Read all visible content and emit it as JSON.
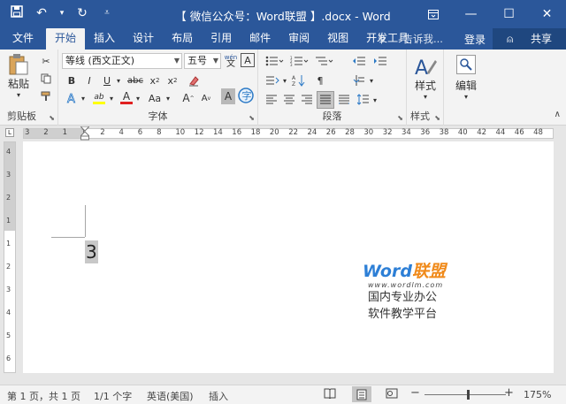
{
  "titlebar": {
    "title": "【 微信公众号：Word联盟 】.docx - Word",
    "qat": {
      "save": "save-icon",
      "undo": "undo-icon",
      "redo": "redo-icon",
      "customize": "customize-icon"
    }
  },
  "tabs": [
    "文件",
    "开始",
    "插入",
    "设计",
    "布局",
    "引用",
    "邮件",
    "审阅",
    "视图",
    "开发工具"
  ],
  "active_tab": "开始",
  "tell_me": "告诉我...",
  "signin": "登录",
  "share": "共享",
  "ribbon": {
    "clipboard": {
      "label": "剪贴板",
      "paste": "粘贴"
    },
    "font": {
      "label": "字体",
      "font_name": "等线 (西文正文)",
      "font_size": "五号",
      "phonetic": "wén"
    },
    "paragraph": {
      "label": "段落"
    },
    "styles": {
      "label": "样式",
      "button": "样式"
    },
    "editing": {
      "button": "编辑"
    }
  },
  "ruler": {
    "h_numbers": [
      "3",
      "2",
      "1",
      "1",
      "2",
      "4",
      "6",
      "8",
      "10",
      "12",
      "14",
      "16",
      "18",
      "20",
      "22",
      "24",
      "26",
      "28",
      "30",
      "32",
      "34",
      "36",
      "38",
      "40",
      "42",
      "44",
      "46",
      "48"
    ],
    "v_numbers": [
      "4",
      "3",
      "2",
      "1",
      "1",
      "2",
      "3",
      "4",
      "5",
      "6"
    ]
  },
  "document": {
    "text": "3",
    "watermark": {
      "brand_a": "Word",
      "brand_b": "联盟",
      "url": "www.wordlm.com",
      "line1": "国内专业办公",
      "line2": "软件教学平台"
    }
  },
  "status": {
    "page": "第 1 页，共 1 页",
    "words": "1/1 个字",
    "language": "英语(美国)",
    "mode": "插入",
    "zoom": "175%"
  }
}
